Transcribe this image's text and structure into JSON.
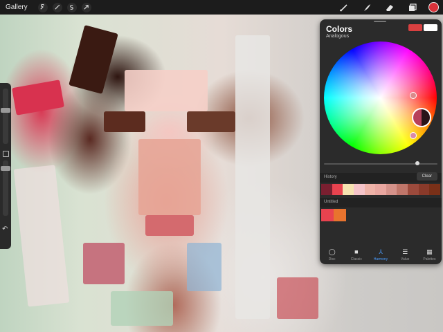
{
  "topbar": {
    "gallery_label": "Gallery",
    "left_tools": [
      "wrench-icon",
      "magic-wand-icon",
      "selection-s-icon",
      "arrow-transform-icon"
    ],
    "right_tools": [
      "brush-icon",
      "smudge-icon",
      "eraser-icon",
      "layers-icon"
    ],
    "current_color": "#d8323a"
  },
  "colors_panel": {
    "title": "Colors",
    "mode": "Analogous",
    "primary_swatch": "#d94040",
    "secondary_swatch": "#ffffff",
    "history_label": "History",
    "clear_label": "Clear",
    "history_swatches": [
      "#7a1f30",
      "#e8434f",
      "#f6e3b0",
      "#f5c4c9",
      "#efb3a8",
      "#e9a7a0",
      "#d5928a",
      "#c0766a",
      "#9c4a3c",
      "#8a3a2a",
      "#7a3018"
    ],
    "palette_label": "Untitled",
    "palette_swatches": [
      "#e8434f",
      "#e8732e"
    ],
    "tabs": [
      {
        "label": "Disc",
        "icon": "disc-icon",
        "active": false
      },
      {
        "label": "Classic",
        "icon": "classic-square-icon",
        "active": false
      },
      {
        "label": "Harmony",
        "icon": "harmony-icon",
        "active": true
      },
      {
        "label": "Value",
        "icon": "value-sliders-icon",
        "active": false
      },
      {
        "label": "Palettes",
        "icon": "palettes-grid-icon",
        "active": false
      }
    ]
  }
}
